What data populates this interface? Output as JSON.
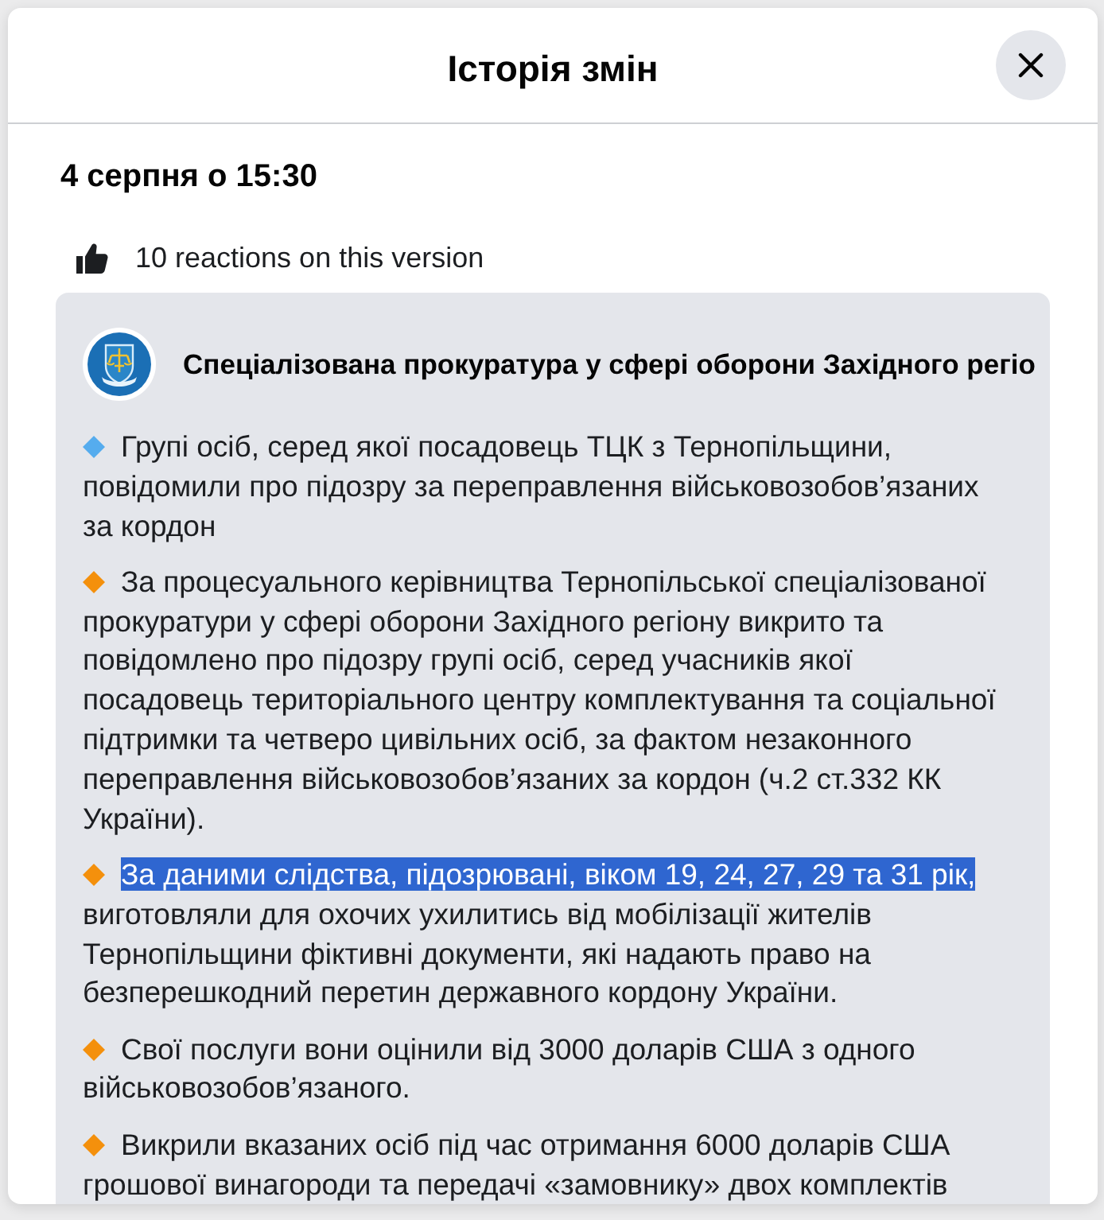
{
  "dialog": {
    "title": "Історія змін"
  },
  "version": {
    "date": "4 серпня о 15:30",
    "reactions": "10 reactions on this version"
  },
  "post": {
    "author": "Спеціалізована прокуратура у сфері оборони Західного регіо",
    "paragraphs": [
      {
        "color": "#55acee",
        "text": "Групі осіб, серед якої посадовець ТЦК з Тернопільщини, повідомили про підозру за переправлення військовозобов’язаних за кордон"
      },
      {
        "color": "#f4900c",
        "text": "За процесуального керівництва Тернопільської спеціалізованої прокуратури у сфері оборони Західного регіону викрито та повідомлено про підозру групі осіб, серед учасників якої посадовець територіального центру комплектування та соціальної підтримки та четверо цивільних осіб, за фактом незаконного переправлення військовозобов’язаних за кордон (ч.2 ст.332 КК України)."
      },
      {
        "color": "#f4900c",
        "selected_text": "За даними слідства, підозрювані, віком 19, 24, 27, 29 та 31 рік,",
        "text": "виготовляли для охочих ухилитись від мобілізації жителів Тернопільщини фіктивні документи, які надають право на безперешкодний перетин державного кордону України."
      },
      {
        "color": "#f4900c",
        "text": "Свої послуги вони оцінили від 3000 доларів США з одного військовозобов’язаного."
      },
      {
        "color": "#f4900c",
        "text": "Викрили вказаних осіб під час отримання 6000 доларів США грошової винагороди та передачі «замовнику» двох комплектів"
      }
    ]
  }
}
